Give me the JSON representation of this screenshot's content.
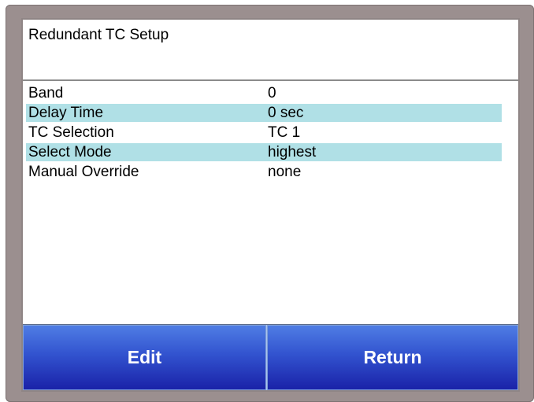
{
  "title": "Redundant TC Setup",
  "rows": [
    {
      "label": "Band",
      "value": "0",
      "highlighted": false
    },
    {
      "label": "Delay Time",
      "value": "0 sec",
      "highlighted": true
    },
    {
      "label": "TC Selection",
      "value": "TC 1",
      "highlighted": false
    },
    {
      "label": "Select Mode",
      "value": "highest",
      "highlighted": true
    },
    {
      "label": "Manual Override",
      "value": "none",
      "highlighted": false
    }
  ],
  "buttons": {
    "edit_label": "Edit",
    "return_label": "Return"
  },
  "colors": {
    "row_highlight": "#b0e0e6",
    "button_top": "#4f7de4",
    "button_bottom": "#1a22a8",
    "bezel": "#9b8f8f"
  }
}
